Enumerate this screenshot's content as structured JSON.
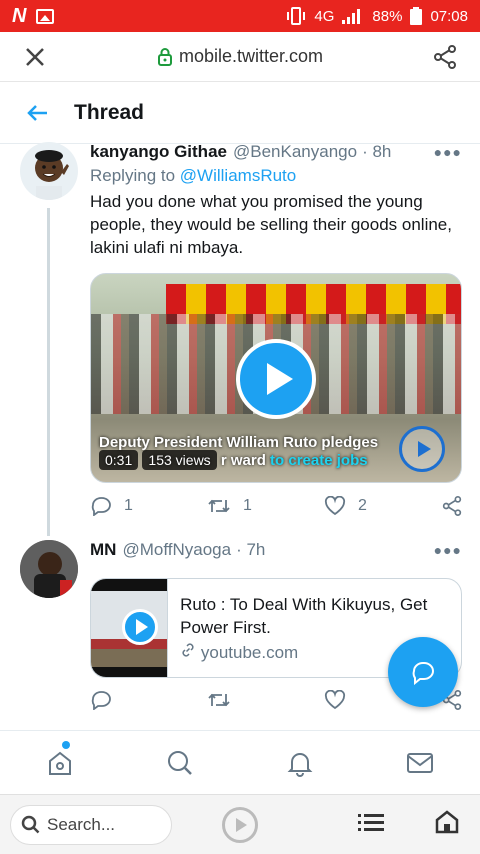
{
  "status_bar": {
    "network": "4G",
    "battery": "88%",
    "time": "07:08",
    "badge": "N"
  },
  "browser": {
    "url": "mobile.twitter.com",
    "search_placeholder": "Search..."
  },
  "header": {
    "title": "Thread"
  },
  "tweets": [
    {
      "name": "kanyango Githae",
      "handle": "@BenKanyango",
      "time": "· 8h",
      "reply_prefix": "Replying to",
      "reply_to": "@WilliamsRuto",
      "text": "Had you done what you promised the young people, they would be selling their goods online, lakini ulafi ni mbaya.",
      "video": {
        "caption_line1": "Deputy President William Ruto pledges",
        "duration": "0:31",
        "views": "153 views",
        "caption_mid": "r ward",
        "caption_end": "to create jobs"
      },
      "replies": "1",
      "retweets": "1",
      "likes": "2"
    },
    {
      "name": "MN",
      "handle": "@MoffNyaoga",
      "time": "· 7h",
      "card": {
        "title": "Ruto : To Deal With Kikuyus, Get Power First.",
        "domain": "youtube.com"
      }
    }
  ],
  "colors": {
    "accent": "#1da1f2",
    "status_bar": "#e8251f"
  },
  "icons": [
    "close-icon",
    "lock-icon",
    "share-icon",
    "back-arrow-icon",
    "more-icon",
    "reply-icon",
    "retweet-icon",
    "like-icon",
    "home-icon",
    "search-icon",
    "bell-icon",
    "mail-icon",
    "compose-icon",
    "list-icon"
  ]
}
